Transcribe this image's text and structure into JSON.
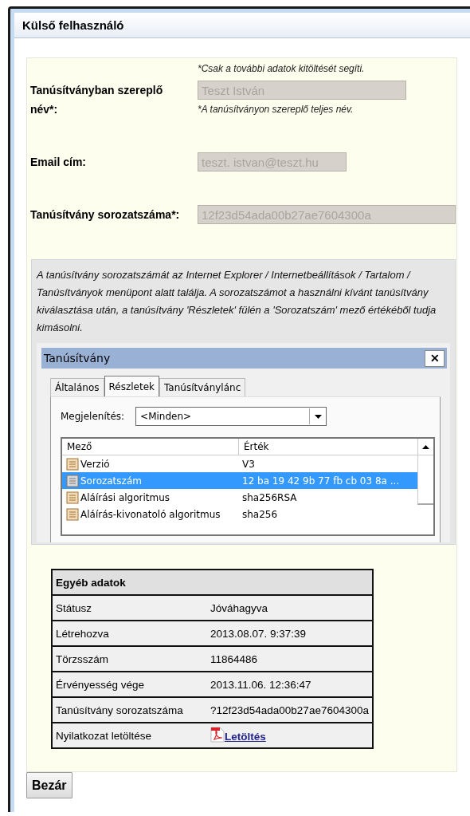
{
  "window": {
    "title": "Külső felhasználó"
  },
  "form": {
    "top_hint": "*Csak a további adatok kitöltését segíti.",
    "fields": [
      {
        "label": "Tanúsítványban szereplő név*:",
        "value": "Teszt István",
        "disabled": true,
        "hint": "*A tanúsítványon szereplő teljes név."
      },
      {
        "label": "Email cím:",
        "value": "teszt. istvan@teszt.hu",
        "disabled": true
      },
      {
        "label": "Tanúsítvány sorozatszáma*:",
        "value": "12f23d54ada00b27ae7604300a",
        "disabled": true
      }
    ]
  },
  "help": {
    "text": "A tanúsítvány sorozatszámát az Internet Explorer / Internetbeállítások / Tartalom / Tanúsítványok menüpont alatt találja. A sorozatszámot a használni kívánt tanúsítvány kiválasztása után, a tanúsítvány 'Részletek' fülén a 'Sorozatszám' mező értékéből tudja kimásolni.",
    "dialog": {
      "title": "Tanúsítvány",
      "close": "✕",
      "tabs": [
        {
          "label": "Általános",
          "selected": false
        },
        {
          "label": "Részletek",
          "selected": true
        },
        {
          "label": "Tanúsítványlánc",
          "selected": false
        }
      ],
      "show_label": "Megjelenítés:",
      "show_value": "<Minden>",
      "columns": [
        "Mező",
        "Érték"
      ],
      "rows": [
        {
          "field": "Verzió",
          "value": "V3",
          "selected": false
        },
        {
          "field": "Sorozatszám",
          "value": "12 ba 19 42 9b 77 fb cb 03 8a ...",
          "selected": true
        },
        {
          "field": "Aláírási algoritmus",
          "value": "sha256RSA",
          "selected": false
        },
        {
          "field": "Aláírás-kivonatoló algoritmus",
          "value": "sha256",
          "selected": false
        }
      ]
    }
  },
  "other": {
    "title": "Egyéb adatok",
    "rows": [
      {
        "label": "Státusz",
        "value": "Jóváhagyva",
        "kind": "text"
      },
      {
        "label": "Létrehozva",
        "value": "2013.08.07. 9:37:39",
        "kind": "text"
      },
      {
        "label": "Törzsszám",
        "value": "11864486",
        "kind": "text"
      },
      {
        "label": "Érvényesség vége",
        "value": "2013.11.06. 12:36:47",
        "kind": "text"
      },
      {
        "label": "Tanúsítvány sorozatszáma",
        "value": "?12f23d54ada00b27ae7604300a",
        "kind": "text"
      },
      {
        "label": "Nyilatkozat letöltése",
        "value": "Letöltés",
        "kind": "link"
      }
    ]
  },
  "buttons": [
    "Bezár"
  ]
}
